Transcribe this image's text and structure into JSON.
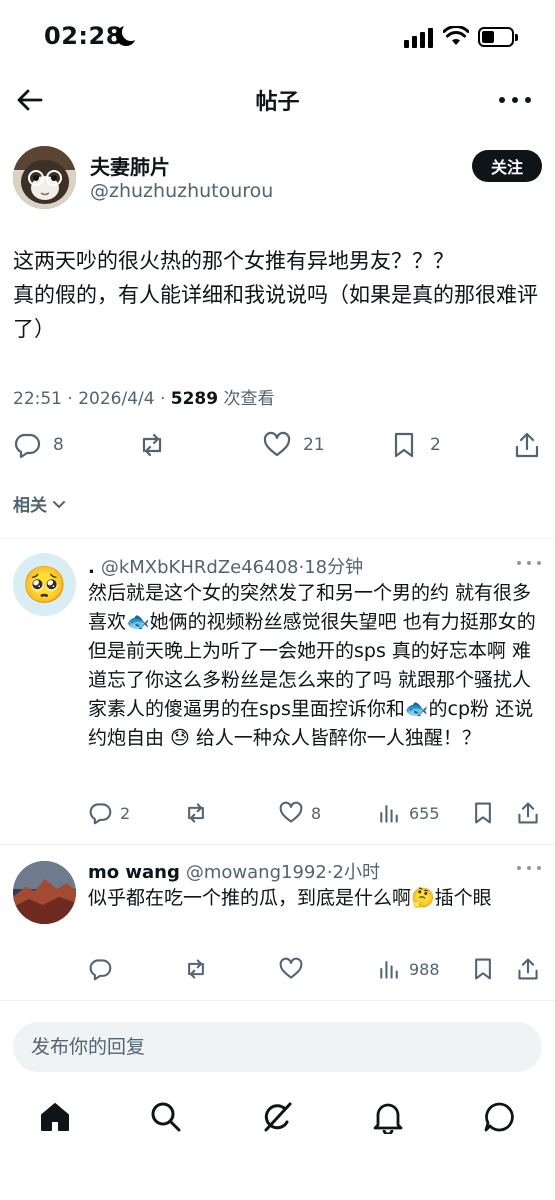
{
  "status": {
    "time": "02:28"
  },
  "header": {
    "title": "帖子"
  },
  "post": {
    "author_name": "夫妻肺片",
    "author_handle": "@zhuzhuzhutourou",
    "follow_label": "关注",
    "text": "这两天吵的很火热的那个女推有异地男友？？？\n真的假的，有人能详细和我说说吗（如果是真的那很难评了）",
    "time_date": "22:51 · 2026/4/4 · ",
    "views_count": "5289",
    "views_label": " 次查看",
    "reply_count": "8",
    "like_count": "21",
    "bookmark_count": "2"
  },
  "related_label": "相关",
  "comments": [
    {
      "name": ".",
      "handle": "@kMXbKHRdZe46408",
      "time": "·18分钟",
      "avatar_emoji": "🥺",
      "text": "然后就是这个女的突然发了和另一个男的约 就有很多喜欢🐟她俩的视频粉丝感觉很失望吧 也有力挺那女的 但是前天晚上为听了一会她开的sps 真的好忘本啊 难道忘了你这么多粉丝是怎么来的了吗 就跟那个骚扰人家素人的傻逼男的在sps里面控诉你和🐟的cp粉 还说约炮自由 😓 给人一种众人皆醉你一人独醒！？",
      "reply_count": "2",
      "like_count": "8",
      "view_count": "655"
    },
    {
      "name": "mo wang",
      "handle": "@mowang1992",
      "time": "·2小时",
      "text": "似乎都在吃一个推的瓜，到底是什么啊🤔插个眼",
      "reply_count": "",
      "like_count": "",
      "view_count": "988"
    }
  ],
  "reply_box": {
    "placeholder": "发布你的回复"
  },
  "nav": [
    "home-icon",
    "search-icon",
    "grok-icon",
    "notifications-icon",
    "messages-icon"
  ],
  "colors": {
    "text": "#0f1419",
    "secondary": "#536471",
    "divider": "#eff3f4"
  }
}
